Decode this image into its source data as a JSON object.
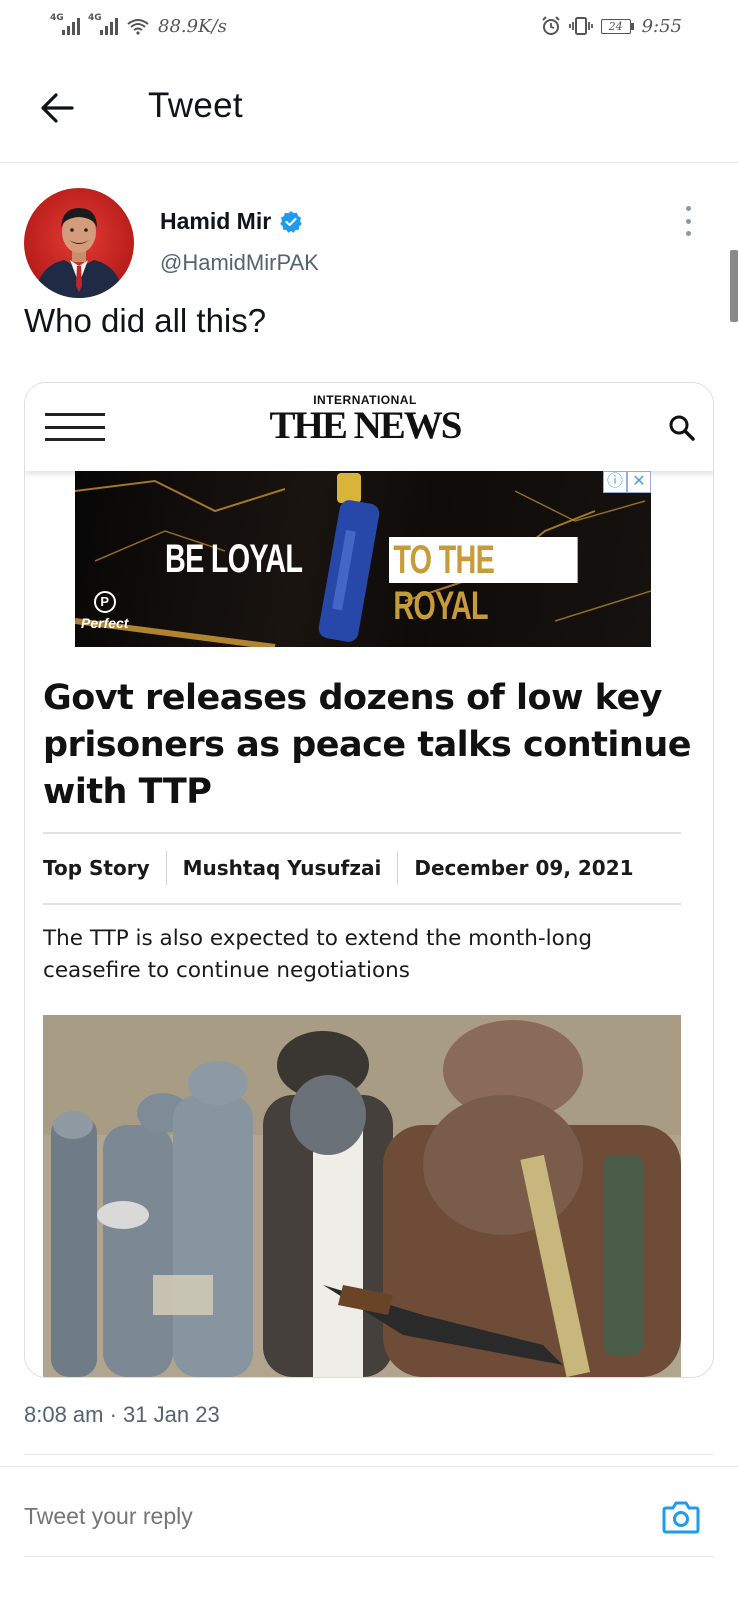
{
  "status_bar": {
    "network_1": "4G",
    "network_2": "4G",
    "speed": "88.9K/s",
    "battery": "24",
    "time": "9:55"
  },
  "header": {
    "title": "Tweet"
  },
  "tweet": {
    "author_name": "Hamid Mir",
    "author_handle": "@HamidMirPAK",
    "text": "Who did all this?",
    "timestamp": "8:08 am · 31 Jan 23"
  },
  "card": {
    "site_logo_small": "INTERNATIONAL",
    "site_logo_big": "THE NEWS",
    "ad": {
      "left_text": "BE LOYAL",
      "right_text": "TO THE ROYAL",
      "brand": "Perfect"
    },
    "headline": "Govt releases dozens of low key prisoners as peace talks continue with TTP",
    "category": "Top Story",
    "byline": "Mushtaq Yusufzai",
    "date": "December 09, 2021",
    "excerpt": "The TTP is also expected to extend the month-long ceasefire to continue negotiations"
  },
  "reply": {
    "placeholder": "Tweet your reply"
  },
  "colors": {
    "accent": "#1d9bf0",
    "muted": "#536471"
  }
}
